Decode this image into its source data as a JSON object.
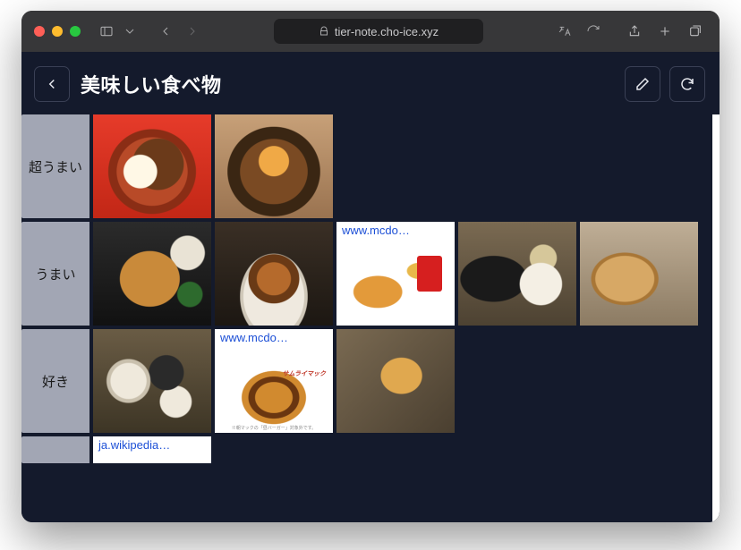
{
  "browser": {
    "url_host": "tier-note.cho-ice.xyz"
  },
  "page": {
    "title": "美味しい食べ物"
  },
  "tiers": [
    {
      "label": "超うまい",
      "items": [
        {
          "kind": "ramen",
          "caption": null
        },
        {
          "kind": "gyudon",
          "caption": null
        }
      ]
    },
    {
      "label": "うまい",
      "items": [
        {
          "kind": "tonkatsu",
          "caption": null
        },
        {
          "kind": "burger",
          "caption": null
        },
        {
          "kind": "mcdo",
          "caption": "www.mcdo…"
        },
        {
          "kind": "teishoku",
          "caption": null
        },
        {
          "kind": "bun",
          "caption": null
        }
      ]
    },
    {
      "label": "好き",
      "items": [
        {
          "kind": "bowls",
          "caption": null
        },
        {
          "kind": "samurai",
          "caption": "www.mcdo…",
          "badge": "サムライマック",
          "fineprint": "※朝マックの「昼バーガー」対象外です。"
        },
        {
          "kind": "kushi",
          "caption": null
        }
      ]
    },
    {
      "label": "",
      "items": [
        {
          "kind": "blank",
          "caption": "ja.wikipedia…"
        }
      ]
    }
  ]
}
